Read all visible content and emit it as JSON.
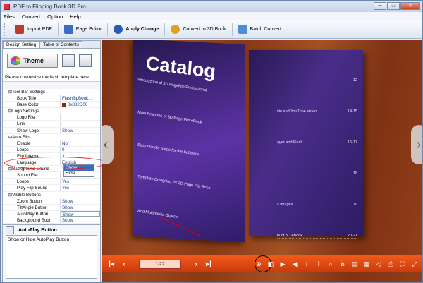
{
  "window": {
    "title": "PDF to Flipping Book 3D Pro",
    "buttons": {
      "min": "─",
      "max": "□",
      "close": "✕"
    }
  },
  "menu": [
    "Files",
    "Convert",
    "Option",
    "Help"
  ],
  "toolbar": [
    {
      "label": "Import PDF",
      "icon": "import-pdf-icon",
      "color": "#c0392b"
    },
    {
      "label": "Page Editor",
      "icon": "page-editor-icon",
      "color": "#3b6cc4"
    },
    {
      "label": "Apply Change",
      "icon": "apply-change-icon",
      "color": "#2a5db0"
    },
    {
      "label": "Convert to 3D Book",
      "icon": "convert-icon",
      "color": "#e0a020"
    },
    {
      "label": "Batch Convert",
      "icon": "batch-convert-icon",
      "color": "#4a8fd8"
    }
  ],
  "left": {
    "tabs": [
      "Design Setting",
      "Table of Contents"
    ],
    "theme_label": "Theme",
    "hint": "Please customize the flash template here",
    "props": [
      {
        "k": "⊟Tool Bar Settings",
        "v": "",
        "grp": true
      },
      {
        "k": "Book Title",
        "v": "FlashflipBook..."
      },
      {
        "k": "Base Color",
        "v": "0x882D00",
        "swatch": true
      },
      {
        "k": "⊟Logo Settings",
        "v": "",
        "grp": true
      },
      {
        "k": "Logo File",
        "v": ""
      },
      {
        "k": "Link",
        "v": ""
      },
      {
        "k": "Show Logo",
        "v": "Show"
      },
      {
        "k": "⊟Auto Flip",
        "v": "",
        "grp": true
      },
      {
        "k": "Enable",
        "v": "No"
      },
      {
        "k": "Loops",
        "v": "0"
      },
      {
        "k": "Flip Interval",
        "v": "3"
      },
      {
        "k": "Language",
        "v": "English"
      },
      {
        "k": "⊟Background Sound",
        "v": "",
        "grp": true
      },
      {
        "k": "Sound File",
        "v": ""
      },
      {
        "k": "Loops",
        "v": "Yes"
      },
      {
        "k": "Play Flip Sound",
        "v": "Yes"
      },
      {
        "k": "⊟Visible Buttons",
        "v": "",
        "grp": true
      },
      {
        "k": "Zoom Button",
        "v": "Show"
      },
      {
        "k": "TiltAngle Button",
        "v": "Show"
      },
      {
        "k": "AutoPlay Button",
        "v": "Show",
        "sel": true
      },
      {
        "k": "Background Soun",
        "v": "Show"
      }
    ],
    "dropdown": [
      "Show",
      "Hide"
    ],
    "desc_title": "AutoPlay Button",
    "desc_text": "Show or Hide AutoPlay Button"
  },
  "book": {
    "cover_title": "Catalog",
    "left_items": [
      "Introduction of 3D PageFlip Professional",
      "Main Features of 3D Page Flip eBook",
      "Easy Handle Steps for the Software",
      "Template Designing for 3D Page Flip Book",
      "Add Multimedia Objects"
    ],
    "right_items": [
      {
        "t": "",
        "p": "12"
      },
      {
        "t": "vie and YouTube Video",
        "p": "14-15"
      },
      {
        "t": "ayer and Flash",
        "p": "16-17"
      },
      {
        "t": "",
        "p": "18"
      },
      {
        "t": "s Images",
        "p": "19"
      },
      {
        "t": "ts of 3D eBook",
        "p": "20-21"
      }
    ]
  },
  "playbar": {
    "page": "1/22",
    "controls": [
      "zoom-in-icon",
      "tilt-icon",
      "play-icon",
      "sound-icon",
      "info-icon",
      "download-icon",
      "search-icon",
      "share-icon",
      "print-icon",
      "thumbnails-icon",
      "share2-icon",
      "print2-icon",
      "fullscreen-icon",
      "expand-icon"
    ]
  }
}
